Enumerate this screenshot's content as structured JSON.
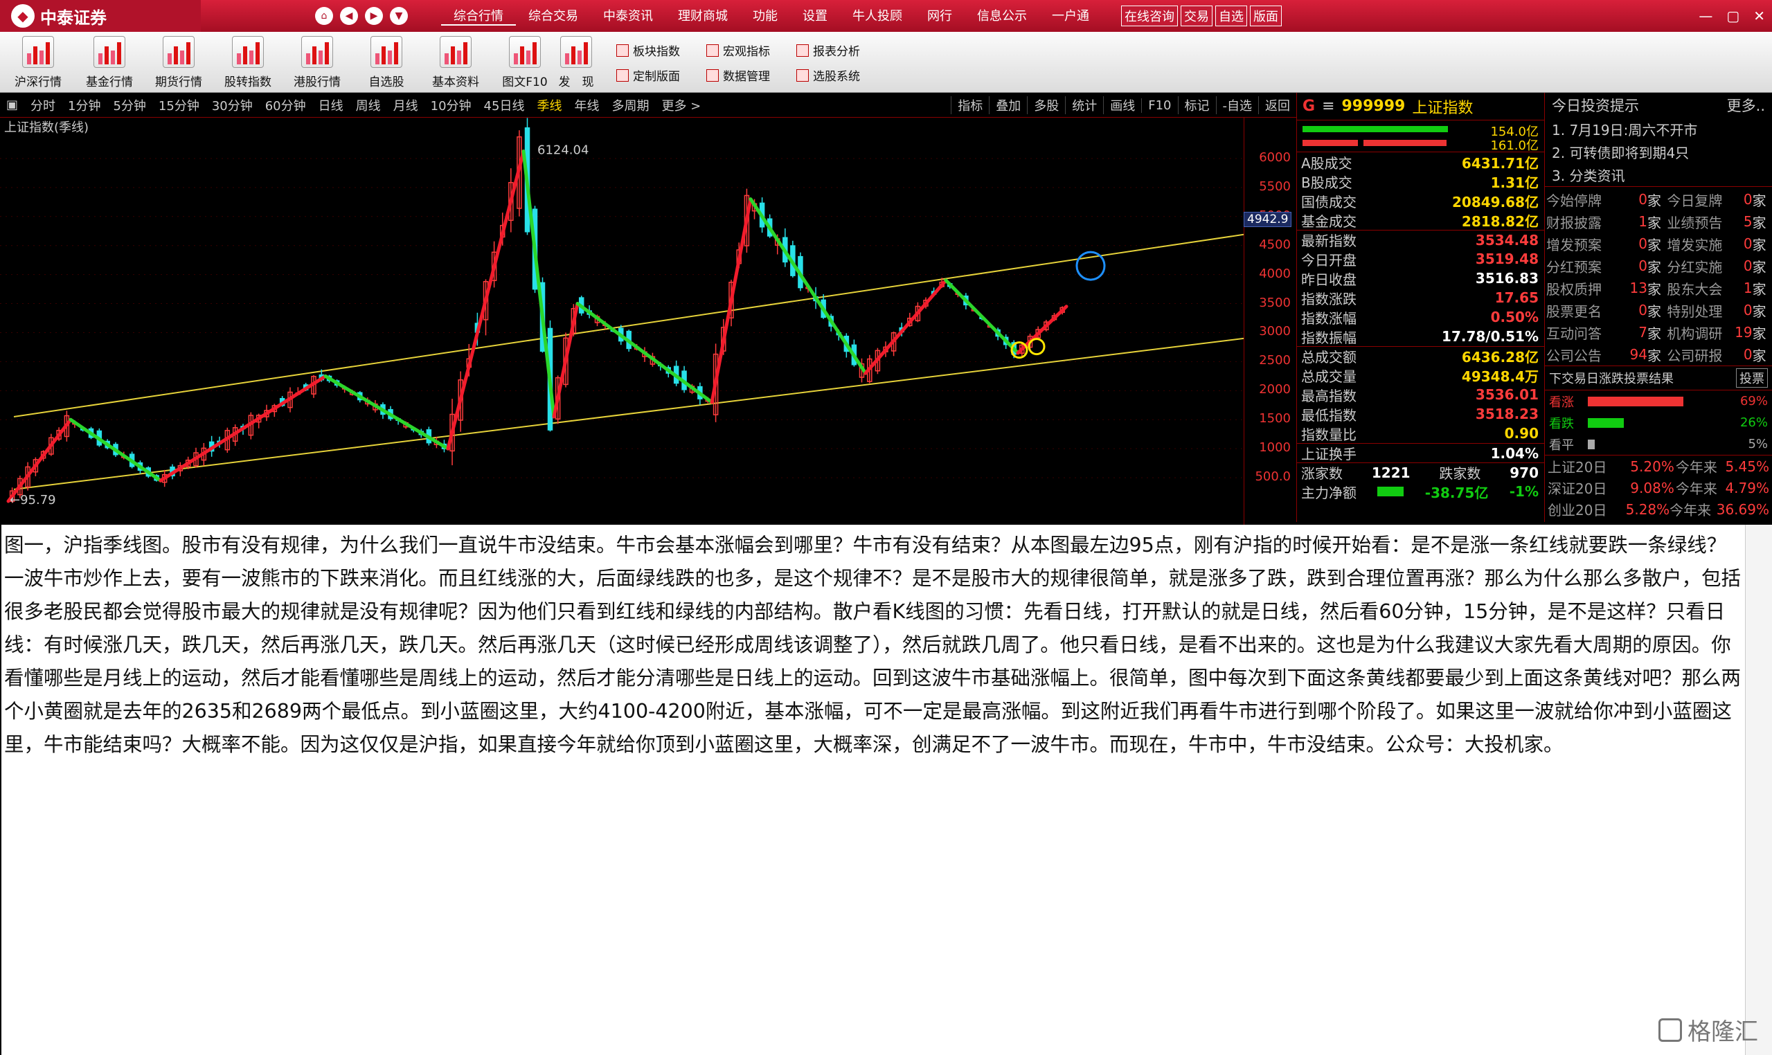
{
  "app": {
    "brand": "中泰证券",
    "menu": [
      "综合行情",
      "综合交易",
      "中泰资讯",
      "理财商城",
      "功能",
      "设置",
      "牛人投顾",
      "网行",
      "信息公示",
      "一户通"
    ],
    "quick_buttons": [
      "在线咨询",
      "交易",
      "自选",
      "版面"
    ],
    "window_controls": [
      "—",
      "▢",
      "✕"
    ]
  },
  "toolbar": {
    "items": [
      "沪深行情",
      "基金行情",
      "期货行情",
      "股转指数",
      "港股行情",
      "自选股",
      "基本资料",
      "图文F10",
      "发　现"
    ],
    "small": [
      "板块指数",
      "宏观指标",
      "报表分析",
      "定制版面",
      "数据管理",
      "选股系统"
    ]
  },
  "periods": [
    "分时",
    "1分钟",
    "5分钟",
    "15分钟",
    "30分钟",
    "60分钟",
    "日线",
    "周线",
    "月线",
    "10分钟",
    "45日线",
    "季线",
    "年线",
    "多周期",
    "更多 >"
  ],
  "active_period": "季线",
  "chart_tools": [
    "指标",
    "叠加",
    "多股",
    "统计",
    "画线",
    "F10",
    "标记",
    "-自选",
    "返回"
  ],
  "chart": {
    "title": "上证指数(季线)",
    "peak_label": "6124.04",
    "low_label": "95.79",
    "current_price": "4942.9",
    "y_ticks": [
      "6000",
      "5500",
      "5000",
      "4500",
      "4000",
      "3500",
      "3000",
      "2500",
      "2000",
      "1500",
      "1000",
      "500.0"
    ]
  },
  "chart_data": {
    "type": "line",
    "title": "上证指数(季线)",
    "ylim": [
      0,
      6300
    ],
    "red_trend_segments": [
      [
        95.79,
        1500
      ],
      [
        450,
        2250
      ],
      [
        1000,
        6124
      ],
      [
        1550,
        3500
      ],
      [
        1800,
        5300
      ],
      [
        2300,
        3900
      ],
      [
        2650,
        3450
      ]
    ],
    "green_trend_segments": [
      [
        1500,
        450
      ],
      [
        2250,
        1000
      ],
      [
        6124,
        1550
      ],
      [
        3500,
        1800
      ],
      [
        5300,
        2300
      ],
      [
        3900,
        2650
      ]
    ],
    "channel_lower": [
      0,
      2900
    ],
    "channel_upper": [
      1550,
      4690
    ],
    "annotations": [
      "yellow circles at 2635 and 2689",
      "blue circle near 4100-4200"
    ]
  },
  "quote": {
    "flag": "G",
    "code": "999999",
    "name": "上证指数",
    "bar_values": [
      "154.0亿",
      "161.0亿"
    ],
    "rows": [
      {
        "label": "A股成交",
        "value": "6431.71亿",
        "cls": "v"
      },
      {
        "label": "B股成交",
        "value": "1.31亿",
        "cls": "v"
      },
      {
        "label": "国债成交",
        "value": "20849.68亿",
        "cls": "v"
      },
      {
        "label": "基金成交",
        "value": "2818.82亿",
        "cls": "v"
      },
      {
        "label": "最新指数",
        "value": "3534.48",
        "cls": "v red"
      },
      {
        "label": "今日开盘",
        "value": "3519.48",
        "cls": "v red"
      },
      {
        "label": "昨日收盘",
        "value": "3516.83",
        "cls": "v white"
      },
      {
        "label": "指数涨跌",
        "value": "17.65",
        "cls": "v red"
      },
      {
        "label": "指数涨幅",
        "value": "0.50%",
        "cls": "v red"
      },
      {
        "label": "指数振幅",
        "value": "17.78/0.51%",
        "cls": "v white"
      },
      {
        "label": "总成交额",
        "value": "6436.28亿",
        "cls": "v"
      },
      {
        "label": "总成交量",
        "value": "49348.4万",
        "cls": "v"
      },
      {
        "label": "最高指数",
        "value": "3536.01",
        "cls": "v red"
      },
      {
        "label": "最低指数",
        "value": "3518.23",
        "cls": "v red"
      },
      {
        "label": "指数量比",
        "value": "0.90",
        "cls": "v"
      },
      {
        "label": "上证换手",
        "value": "1.04%",
        "cls": "v white"
      }
    ],
    "rise_label": "涨家数",
    "rise": "1221",
    "fall_label": "跌家数",
    "fall": "970",
    "main_flow_label": "主力净额",
    "main_flow": "-38.75亿",
    "main_flow_pct": "-1%"
  },
  "news": {
    "title": "今日投资提示",
    "more": "更多..",
    "items": [
      "1. 7月19日:周六不开市",
      "2. 可转债即将到期4只",
      "3. 分类资讯"
    ],
    "stats": [
      [
        "今始停牌",
        "0",
        "家",
        "今日复牌",
        "0",
        "家"
      ],
      [
        "财报披露",
        "1",
        "家",
        "业绩预告",
        "5",
        "家"
      ],
      [
        "增发预案",
        "0",
        "家",
        "增发实施",
        "0",
        "家"
      ],
      [
        "分红预案",
        "0",
        "家",
        "分红实施",
        "0",
        "家"
      ],
      [
        "股权质押",
        "13",
        "家",
        "股东大会",
        "1",
        "家"
      ],
      [
        "股票更名",
        "0",
        "家",
        "特别处理",
        "0",
        "家"
      ],
      [
        "互动问答",
        "7",
        "家",
        "机构调研",
        "19",
        "家"
      ],
      [
        "公司公告",
        "94",
        "家",
        "公司研报",
        "0",
        "家"
      ]
    ],
    "vote_title": "下交易日涨跌投票结果",
    "vote_button": "投票",
    "votes": [
      {
        "label": "看涨",
        "pct": "69%",
        "frac": 0.69,
        "color": "#e33"
      },
      {
        "label": "看跌",
        "pct": "26%",
        "frac": 0.26,
        "color": "#1c1"
      },
      {
        "label": "看平",
        "pct": "5%",
        "frac": 0.05,
        "color": "#aaa"
      }
    ],
    "indices": [
      [
        "上证20日",
        "5.20%",
        "今年来",
        "5.45%"
      ],
      [
        "深证20日",
        "9.08%",
        "今年来",
        "4.79%"
      ],
      [
        "创业20日",
        "5.28%",
        "今年来",
        "36.69%"
      ]
    ]
  },
  "article": {
    "text": "图一，沪指季线图。股市有没有规律，为什么我们一直说牛市没结束。牛市会基本涨幅会到哪里？牛市有没有结束？从本图最左边95点，刚有沪指的时候开始看：是不是涨一条红线就要跌一条绿线？一波牛市炒作上去，要有一波熊市的下跌来消化。而且红线涨的大，后面绿线跌的也多，是这个规律不？是不是股市大的规律很简单，就是涨多了跌，跌到合理位置再涨？那么为什么那么多散户，包括很多老股民都会觉得股市最大的规律就是没有规律呢？因为他们只看到红线和绿线的内部结构。散户看K线图的习惯：先看日线，打开默认的就是日线，然后看60分钟，15分钟，是不是这样？只看日线：有时候涨几天，跌几天，然后再涨几天，跌几天。然后再涨几天（这时候已经形成周线该调整了），然后就跌几周了。他只看日线，是看不出来的。这也是为什么我建议大家先看大周期的原因。你看懂哪些是月线上的运动，然后才能看懂哪些是周线上的运动，然后才能分清哪些是日线上的运动。回到这波牛市基础涨幅上。很简单，图中每次到下面这条黄线都要最少到上面这条黄线对吧？那么两个小黄圈就是去年的2635和2689两个最低点。到小蓝圈这里，大约4100-4200附近，基本涨幅，可不一定是最高涨幅。到这附近我们再看牛市进行到哪个阶段了。如果这里一波就给你冲到小蓝圈这里，牛市能结束吗？大概率不能。因为这仅仅是沪指，如果直接今年就给你顶到小蓝圈这里，大概率深，创满足不了一波牛市。而现在，牛市中，牛市没结束。公众号：大投机家。"
  },
  "watermark": "格隆汇"
}
